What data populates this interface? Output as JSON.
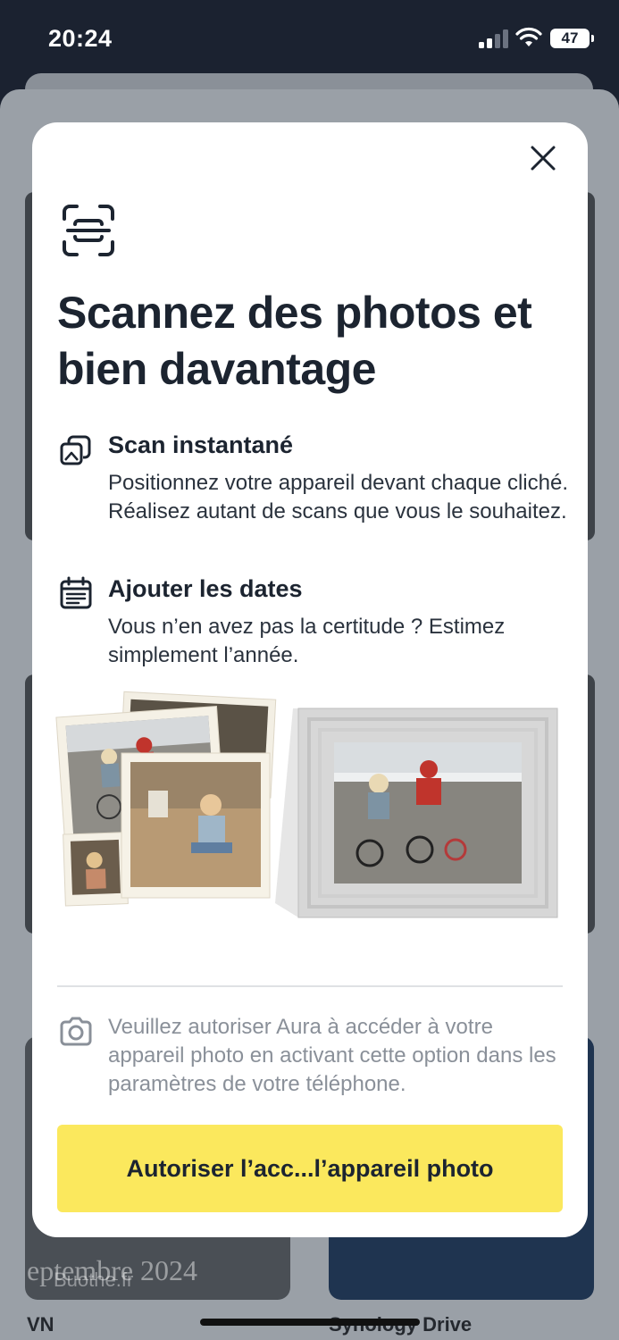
{
  "status_bar": {
    "time": "20:24",
    "battery": "47"
  },
  "modal": {
    "title": "Scannez des photos et bien davantage",
    "features": [
      {
        "title": "Scan instantané",
        "text": "Positionnez votre appareil devant chaque cliché. Réalisez autant de scans que vous le souhaitez.",
        "icon": "photo-stack-icon"
      },
      {
        "title": "Ajouter les dates",
        "text": "Vous n’en avez pas la certitude ? Estimez simplement l’année.",
        "icon": "calendar-icon"
      }
    ],
    "permission_text": "Veuillez autoriser Aura à accéder à votre appareil photo en activant cette option dans les paramètres de votre téléphone.",
    "cta_label": "Autoriser l’acc...l’appareil photo"
  },
  "background": {
    "labels": [
      "VN",
      "Synology Drive"
    ],
    "watermark": "eptembre 2024",
    "watermark_site": "Buothe.fr"
  },
  "colors": {
    "accent": "#fbe85d",
    "text": "#1c2430",
    "muted": "#8a9099"
  }
}
